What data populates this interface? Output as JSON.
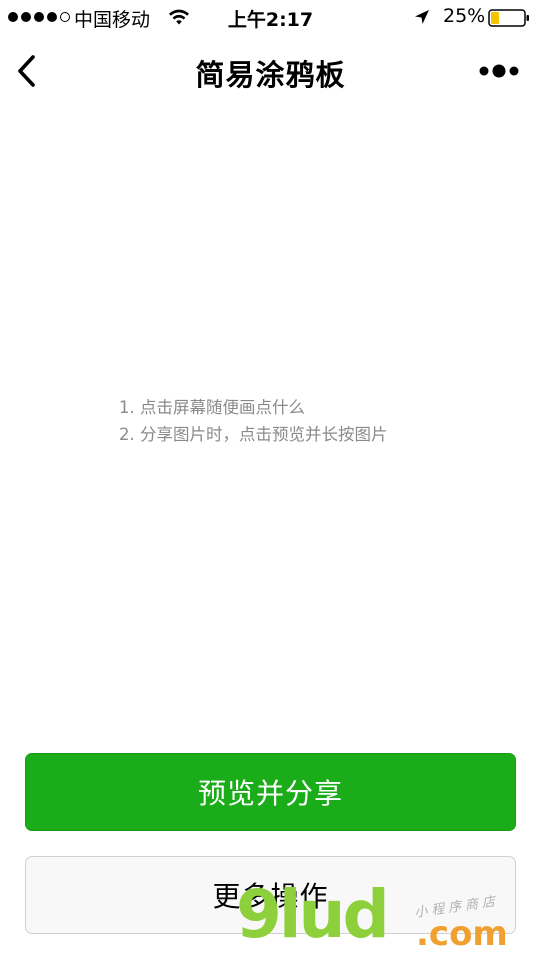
{
  "status_bar": {
    "carrier": "中国移动",
    "time": "上午2:17",
    "battery_percent": "25%",
    "signal_bars_filled": 4,
    "signal_bars_total": 5,
    "battery_level": 0.25,
    "battery_color": "#f5c400"
  },
  "nav": {
    "title": "简易涂鸦板"
  },
  "canvas": {
    "instructions": [
      "1. 点击屏幕随便画点什么",
      "2. 分享图片时，点击预览并长按图片"
    ]
  },
  "buttons": {
    "primary_label": "预览并分享",
    "primary_color": "#1aad19",
    "secondary_label": "更多操作"
  },
  "watermark": {
    "brand": "9lud",
    "domain_suffix": ".com",
    "tagline": "小程序商店"
  }
}
